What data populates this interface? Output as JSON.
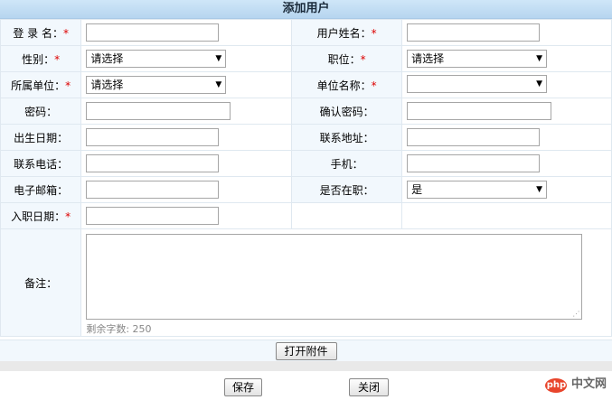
{
  "title": "添加用户",
  "fields": {
    "login_name": "登 录 名：",
    "user_name": "用户姓名：",
    "gender": "性别：",
    "position": "职位：",
    "unit": "所属单位：",
    "unit_name": "单位名称：",
    "password": "密码：",
    "confirm_password": "确认密码：",
    "birthday": "出生日期：",
    "address": "联系地址：",
    "phone": "联系电话：",
    "mobile": "手机：",
    "email": "电子邮箱：",
    "on_job": "是否在职：",
    "entry_date": "入职日期：",
    "remarks": "备注："
  },
  "required_mark": "*",
  "selects": {
    "gender": "请选择",
    "position": "请选择",
    "unit": "请选择",
    "unit_name": "",
    "on_job": "是"
  },
  "remaining_chars": "剩余字数: 250",
  "buttons": {
    "attach": "打开附件",
    "save": "保存",
    "close": "关闭"
  },
  "watermark": {
    "badge": "php",
    "text": "中文网"
  }
}
